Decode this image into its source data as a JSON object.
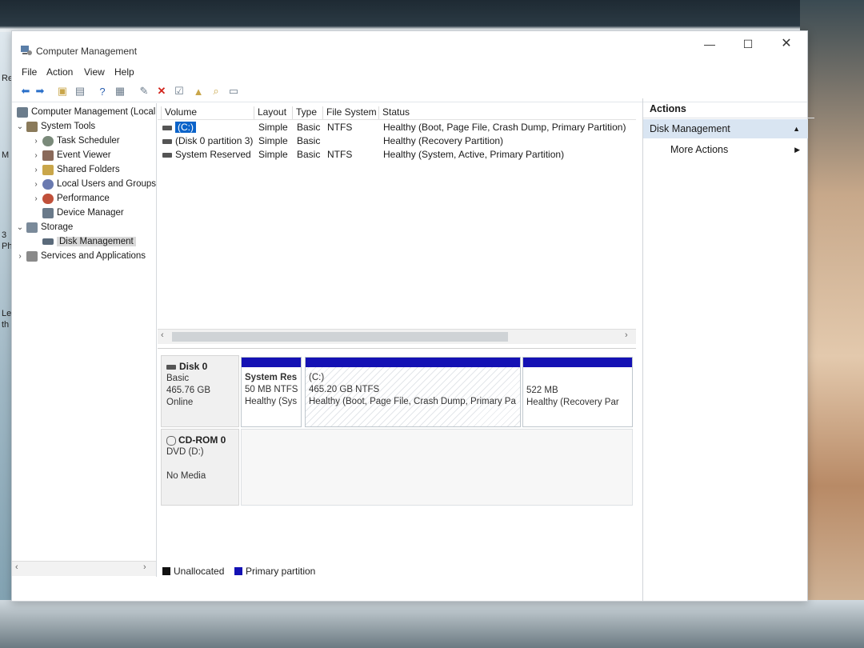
{
  "desktop": {
    "left_texts": [
      "Re",
      "M",
      "3",
      "Phe",
      "Le",
      "th"
    ]
  },
  "window": {
    "title": "Computer Management",
    "controls": {
      "minimize": "—",
      "maximize": "☐",
      "close": "✕"
    }
  },
  "menu": [
    "File",
    "Action",
    "View",
    "Help"
  ],
  "tree": [
    {
      "label": "Computer Management (Local",
      "level": 0,
      "chev": "",
      "icon_color": "#6b7c8c"
    },
    {
      "label": "System Tools",
      "level": 1,
      "chev": "⌄",
      "icon_color": "#8a7a5a"
    },
    {
      "label": "Task Scheduler",
      "level": 2,
      "chev": "›",
      "icon_color": "#7a8a7a"
    },
    {
      "label": "Event Viewer",
      "level": 2,
      "chev": "›",
      "icon_color": "#8a6a5a"
    },
    {
      "label": "Shared Folders",
      "level": 2,
      "chev": "›",
      "icon_color": "#c9a64a"
    },
    {
      "label": "Local Users and Groups",
      "level": 2,
      "chev": "›",
      "icon_color": "#6a7ab0"
    },
    {
      "label": "Performance",
      "level": 2,
      "chev": "›",
      "icon_color": "#c0503a"
    },
    {
      "label": "Device Manager",
      "level": 2,
      "chev": "",
      "icon_color": "#6a7a8a"
    },
    {
      "label": "Storage",
      "level": 1,
      "chev": "⌄",
      "icon_color": "#7a8a9a"
    },
    {
      "label": "Disk Management",
      "level": 2,
      "chev": "",
      "icon_color": "#5a6a7a",
      "selected": true
    },
    {
      "label": "Services and Applications",
      "level": 1,
      "chev": "›",
      "icon_color": "#8a8a8a"
    }
  ],
  "volumes": {
    "headers": [
      "Volume",
      "Layout",
      "Type",
      "File System",
      "Status"
    ],
    "rows": [
      {
        "volume": "(C:)",
        "layout": "Simple",
        "type": "Basic",
        "fs": "NTFS",
        "status": "Healthy (Boot, Page File, Crash Dump, Primary Partition)",
        "selected": true
      },
      {
        "volume": "(Disk 0 partition 3)",
        "layout": "Simple",
        "type": "Basic",
        "fs": "",
        "status": "Healthy (Recovery Partition)"
      },
      {
        "volume": "System Reserved",
        "layout": "Simple",
        "type": "Basic",
        "fs": "NTFS",
        "status": "Healthy (System, Active, Primary Partition)"
      }
    ]
  },
  "disks": {
    "disk0": {
      "name": "Disk 0",
      "type": "Basic",
      "size": "465.76 GB",
      "state": "Online",
      "partitions": [
        {
          "title": "System Res",
          "line1": "50 MB NTFS",
          "line2": "Healthy (Sys"
        },
        {
          "title": "(C:)",
          "line1": "465.20 GB NTFS",
          "line2": "Healthy (Boot, Page File, Crash Dump, Primary Pa"
        },
        {
          "title": "",
          "line1": "522 MB",
          "line2": "Healthy (Recovery Par"
        }
      ]
    },
    "cdrom0": {
      "name": "CD-ROM 0",
      "type": "DVD (D:)",
      "media": "No Media"
    }
  },
  "legend": {
    "unallocated": "Unallocated",
    "primary": "Primary partition",
    "unallocated_color": "#111111",
    "primary_color": "#1411b4"
  },
  "actions": {
    "header": "Actions",
    "section": "Disk Management",
    "more": "More Actions"
  }
}
